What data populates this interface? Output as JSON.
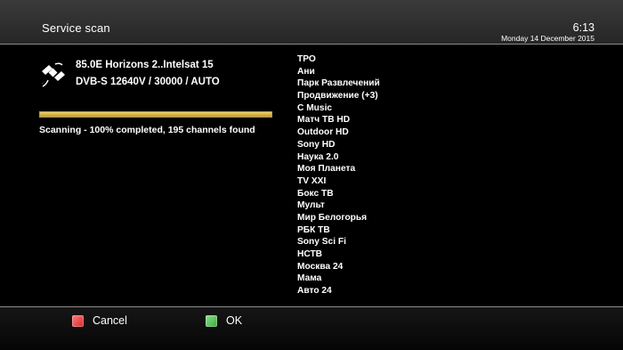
{
  "header": {
    "title": "Service scan",
    "time": "6:13",
    "date": "Monday 14 December 2015"
  },
  "transponder": {
    "satellite": "85.0E Horizons 2..Intelsat 15",
    "parameters": "DVB-S 12640V / 30000 / AUTO",
    "icon": "satellite-icon"
  },
  "scan": {
    "progress_percent": 100,
    "status_text": "Scanning - 100% completed, 195 channels found"
  },
  "channels": [
    "ТРО",
    "Ани",
    "Парк Развлечений",
    "Продвижение (+3)",
    "C Music",
    "Матч ТВ HD",
    "Outdoor HD",
    "Sony HD",
    "Наука 2.0",
    "Моя Планета",
    "TV XXI",
    "Бокс ТВ",
    "Мульт",
    "Мир Белогорья",
    "РБК ТВ",
    "Sony Sci Fi",
    "НСТВ",
    "Москва 24",
    "Мама",
    "Авто 24"
  ],
  "buttons": {
    "cancel_label": "Cancel",
    "ok_label": "OK",
    "cancel_color": "#d42b2b",
    "ok_color": "#3aaa3a"
  },
  "colors": {
    "progress_fill": "#e0b43a",
    "background": "#000000"
  }
}
